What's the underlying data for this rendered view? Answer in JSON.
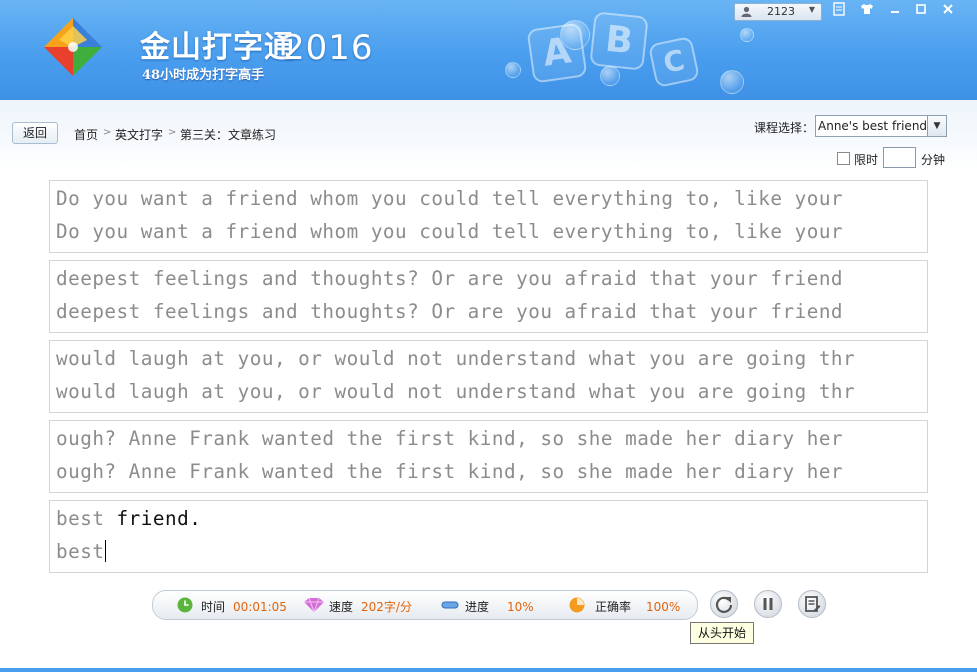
{
  "header": {
    "brand_name": "金山打字通",
    "brand_year": "2016",
    "slogan": "48小时成为打字高手",
    "deco_letters": [
      "A",
      "B",
      "C"
    ],
    "user_name": "2123",
    "window_icons": [
      "skin-icon",
      "shirt-icon",
      "minimize-icon",
      "maximize-icon",
      "close-icon"
    ]
  },
  "nav": {
    "back_label": "返回",
    "breadcrumb": [
      "首页",
      "英文打字",
      "第三关：文章练习"
    ],
    "breadcrumb_sep": ">",
    "course_label": "课程选择：",
    "course_value": "Anne's best friend",
    "limit_label": "限时",
    "limit_value": "",
    "limit_unit": "分钟"
  },
  "rows": [
    {
      "source": "Do you want a friend whom you could tell everything to, like your",
      "typed": "Do you want a friend whom you could tell everything to, like your"
    },
    {
      "source": "deepest feelings and thoughts? Or are you afraid that your friend",
      "typed": "deepest feelings and thoughts? Or are you afraid that your friend"
    },
    {
      "source": "would laugh at you, or would not understand what you are going thr",
      "typed": "would laugh at you, or would not understand what you are going thr"
    },
    {
      "source": "ough? Anne Frank wanted the first kind, so she made her diary her",
      "typed": "ough? Anne Frank wanted the first kind, so she made her diary her"
    },
    {
      "source_done": "best",
      "source_pending": " friend.",
      "typed": "best"
    }
  ],
  "stats": {
    "time_label": "时间",
    "time_value": "00:01:05",
    "speed_label": "速度",
    "speed_value": "202字/分",
    "progress_label": "进度",
    "progress_value": "10%",
    "accuracy_label": "正确率",
    "accuracy_value": "100%"
  },
  "tooltip": "从头开始",
  "colors": {
    "header_blue": "#4a9eee",
    "value_orange": "#e2640a",
    "typed_gray": "#8c8c8c"
  }
}
